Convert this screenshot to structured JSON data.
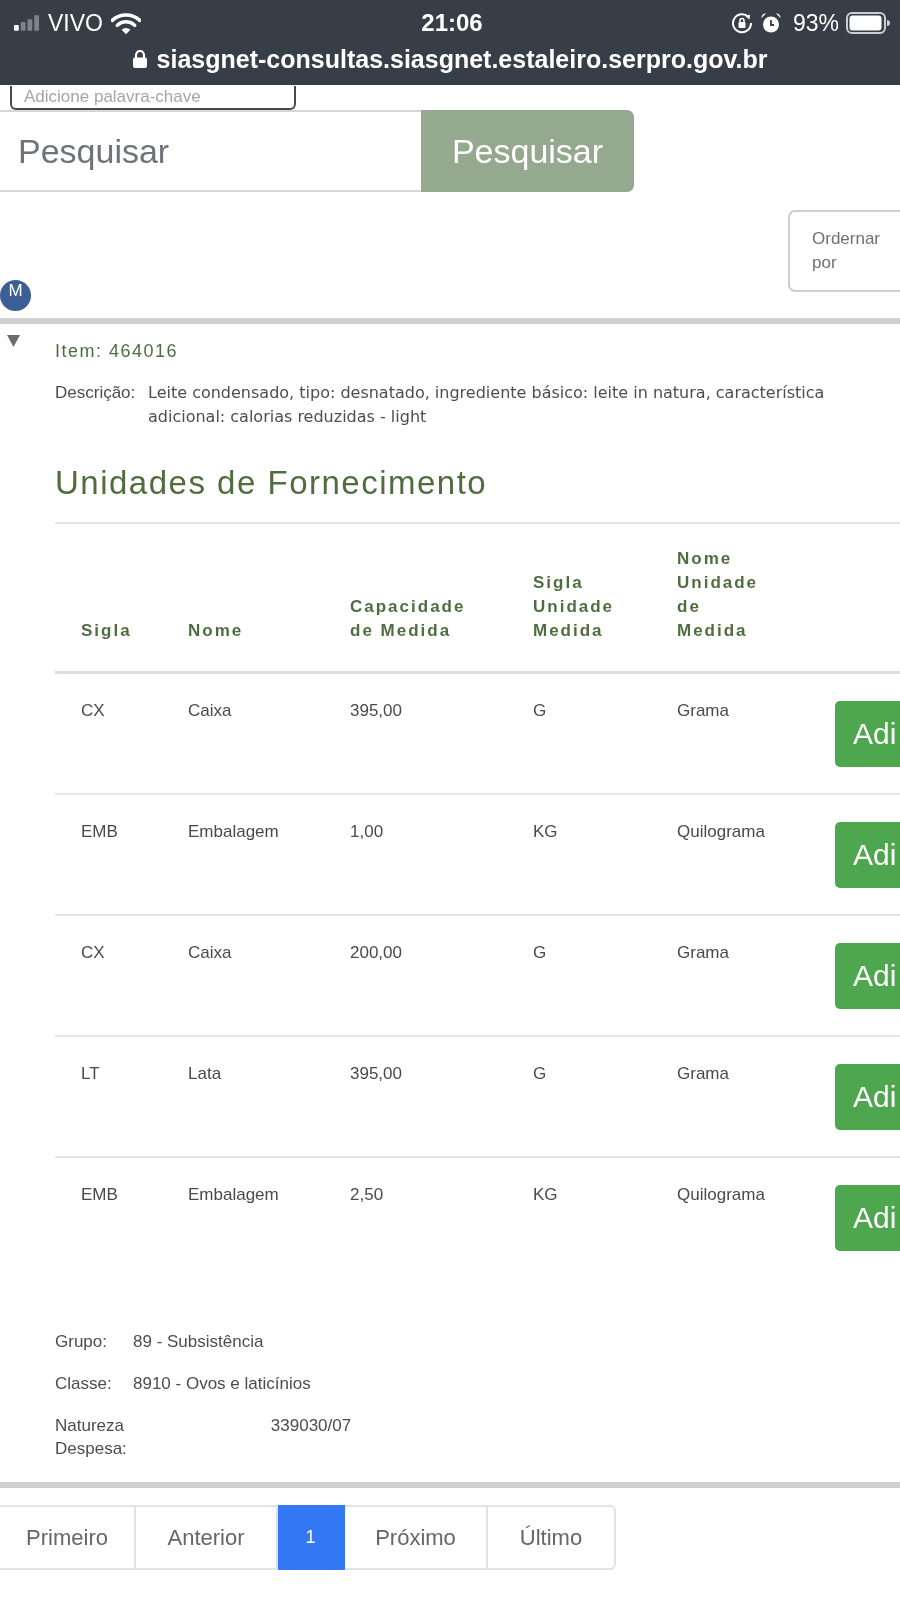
{
  "status_bar": {
    "carrier": "VIVO",
    "time": "21:06",
    "battery": "93%",
    "url": "siasgnet-consultas.siasgnet.estaleiro.serpro.gov.br"
  },
  "keyword_field": {
    "placeholder": "Adicione palavra-chave"
  },
  "search": {
    "placeholder": "Pesquisar",
    "button": "Pesquisar"
  },
  "sort_button": {
    "label": "Ordernar por"
  },
  "avatar": {
    "initial": "M"
  },
  "item": {
    "expanded": true,
    "title": "Item: 464016",
    "description_label": "Descrição:",
    "description": "Leite condensado, tipo: desnatado, ingrediente básico: leite in natura, característica adicional: calorias reduzidas - light"
  },
  "section_title": "Unidades de Fornecimento",
  "table": {
    "columns": [
      "Sigla",
      "Nome",
      "Capacidade de Medida",
      "Sigla Unidade Medida",
      "Nome Unidade de Medida"
    ],
    "rows": [
      {
        "cells": [
          "CX",
          "Caixa",
          "395,00",
          "G",
          "Grama"
        ],
        "action": "Adi"
      },
      {
        "cells": [
          "EMB",
          "Embalagem",
          "1,00",
          "KG",
          "Quilograma"
        ],
        "action": "Adi"
      },
      {
        "cells": [
          "CX",
          "Caixa",
          "200,00",
          "G",
          "Grama"
        ],
        "action": "Adi"
      },
      {
        "cells": [
          "LT",
          "Lata",
          "395,00",
          "G",
          "Grama"
        ],
        "action": "Adi"
      },
      {
        "cells": [
          "EMB",
          "Embalagem",
          "2,50",
          "KG",
          "Quilograma"
        ],
        "action": "Adi"
      }
    ]
  },
  "details": [
    {
      "kind": "pair",
      "label": "Grupo:",
      "value": "89 - Subsistência"
    },
    {
      "kind": "pair",
      "label": "Classe:",
      "value": "8910 - Ovos e laticínios"
    },
    {
      "kind": "wide",
      "label": "Natureza Despesa:",
      "value": "339030/07"
    }
  ],
  "pagination": [
    {
      "label": "Primeiro",
      "selected": false
    },
    {
      "label": "Anterior",
      "selected": false
    },
    {
      "label": "1",
      "selected": true
    },
    {
      "label": "Próximo",
      "selected": false
    },
    {
      "label": "Último",
      "selected": false
    }
  ]
}
